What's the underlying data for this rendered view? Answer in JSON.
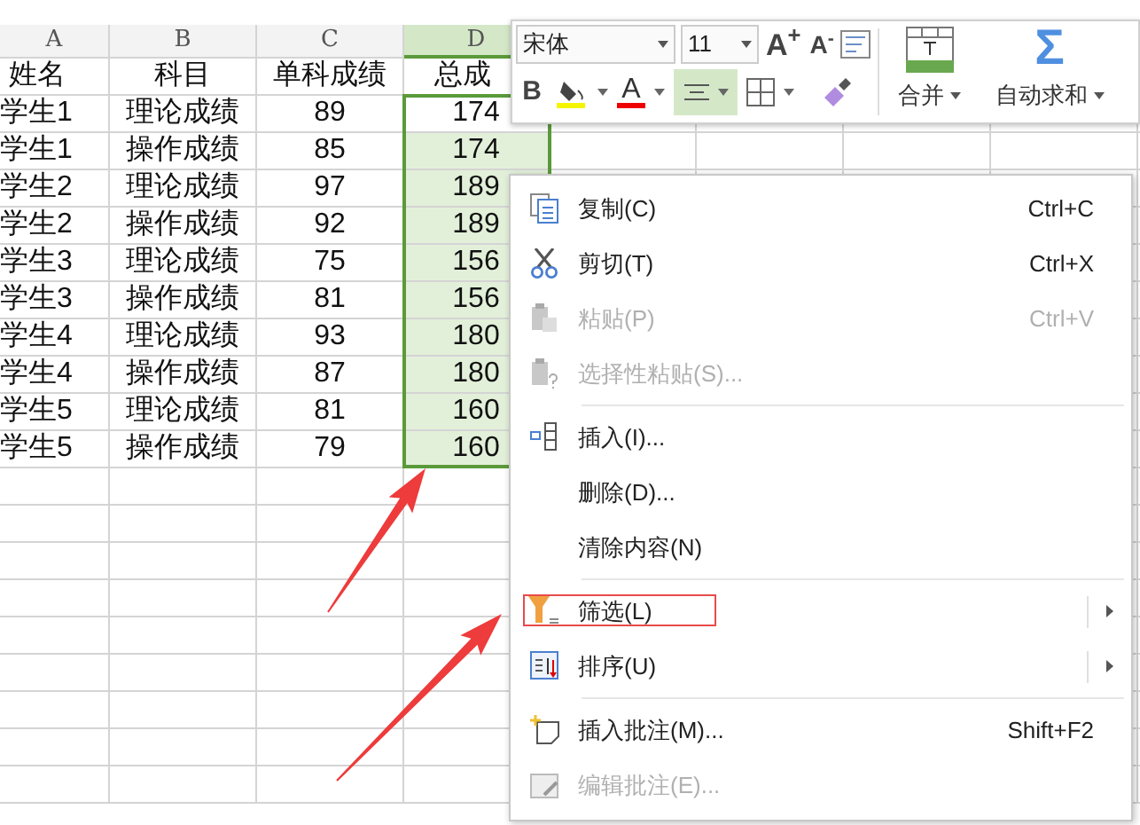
{
  "sheet": {
    "columns": [
      {
        "letter": "A",
        "selected": false
      },
      {
        "letter": "B",
        "selected": false
      },
      {
        "letter": "C",
        "selected": false
      },
      {
        "letter": "D",
        "selected": true
      }
    ],
    "header_row": [
      "姓名",
      "科目",
      "单科成绩",
      "总成"
    ],
    "rows": [
      {
        "cells": [
          "学生1",
          "理论成绩",
          "89",
          "174"
        ],
        "selected": true,
        "active": true
      },
      {
        "cells": [
          "学生1",
          "操作成绩",
          "85",
          "174"
        ],
        "selected": true,
        "active": false
      },
      {
        "cells": [
          "学生2",
          "理论成绩",
          "97",
          "189"
        ],
        "selected": true,
        "active": false
      },
      {
        "cells": [
          "学生2",
          "操作成绩",
          "92",
          "189"
        ],
        "selected": true,
        "active": false
      },
      {
        "cells": [
          "学生3",
          "理论成绩",
          "75",
          "156"
        ],
        "selected": true,
        "active": false
      },
      {
        "cells": [
          "学生3",
          "操作成绩",
          "81",
          "156"
        ],
        "selected": true,
        "active": false
      },
      {
        "cells": [
          "学生4",
          "理论成绩",
          "93",
          "180"
        ],
        "selected": true,
        "active": false
      },
      {
        "cells": [
          "学生4",
          "操作成绩",
          "87",
          "180"
        ],
        "selected": true,
        "active": false
      },
      {
        "cells": [
          "学生5",
          "理论成绩",
          "81",
          "160"
        ],
        "selected": true,
        "active": false
      },
      {
        "cells": [
          "学生5",
          "操作成绩",
          "79",
          "160"
        ],
        "selected": true,
        "active": false
      }
    ]
  },
  "toolbar": {
    "font_name": "宋体",
    "font_size": "11",
    "grow_font": "A$^{+}$",
    "shrink_font": "A$^{-}$",
    "bold": "B",
    "font_color": "A",
    "align_center_selected": true,
    "merge": "合并",
    "autosum_symbol": "Σ",
    "autosum": "自动求和"
  },
  "context_menu": [
    {
      "kind": "copy",
      "label": "复制(C)",
      "shortcut": "Ctrl+C",
      "disabled": false,
      "submenu": false,
      "separator_before": false,
      "annotated": false
    },
    {
      "kind": "cut",
      "label": "剪切(T)",
      "shortcut": "Ctrl+X",
      "disabled": false,
      "submenu": false,
      "separator_before": false,
      "annotated": false
    },
    {
      "kind": "paste",
      "label": "粘贴(P)",
      "shortcut": "Ctrl+V",
      "disabled": true,
      "submenu": false,
      "separator_before": false,
      "annotated": false
    },
    {
      "kind": "paste_special",
      "label": "选择性粘贴(S)...",
      "disabled": true,
      "submenu": false,
      "separator_before": false,
      "annotated": false
    },
    {
      "kind": "insert",
      "label": "插入(I)...",
      "disabled": false,
      "submenu": false,
      "separator_before": true,
      "annotated": false
    },
    {
      "kind": "plain",
      "label": "删除(D)...",
      "disabled": false,
      "submenu": false,
      "separator_before": false,
      "annotated": false
    },
    {
      "kind": "plain",
      "label": "清除内容(N)",
      "disabled": false,
      "submenu": false,
      "separator_before": false,
      "annotated": false
    },
    {
      "kind": "filter",
      "label": "筛选(L)",
      "disabled": false,
      "submenu": true,
      "separator_before": true,
      "annotated": true
    },
    {
      "kind": "sort",
      "label": "排序(U)",
      "disabled": false,
      "submenu": true,
      "separator_before": false,
      "annotated": false
    },
    {
      "kind": "comment",
      "label": "插入批注(M)...",
      "shortcut": "Shift+F2",
      "disabled": false,
      "submenu": false,
      "separator_before": true,
      "annotated": false
    },
    {
      "kind": "edit_comment",
      "label": "编辑批注(E)...",
      "disabled": true,
      "submenu": false,
      "separator_before": false,
      "annotated": false
    }
  ],
  "annotations": [
    {
      "kind": "arrow"
    },
    {
      "kind": "arrow"
    }
  ]
}
